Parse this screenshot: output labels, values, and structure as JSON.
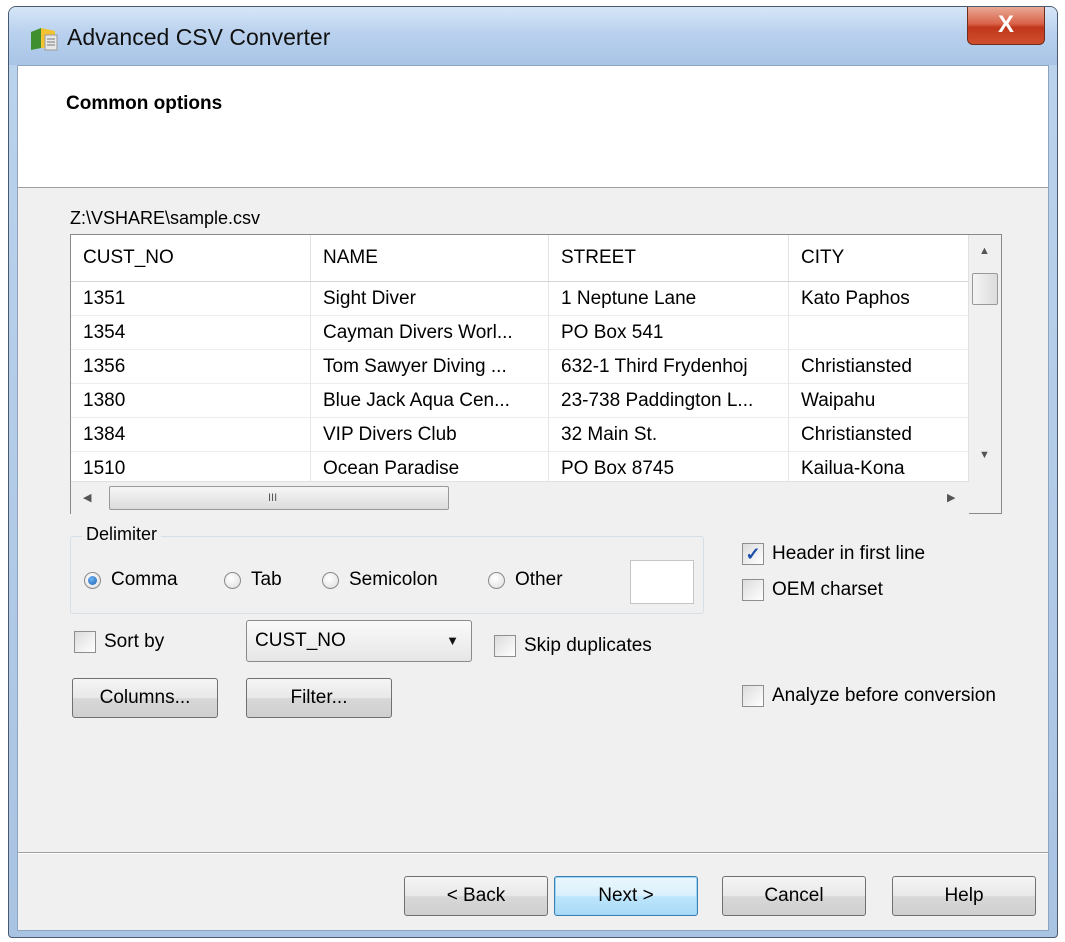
{
  "window": {
    "title": "Advanced CSV Converter",
    "close_glyph": "X"
  },
  "page": {
    "title": "Common options",
    "file_path": "Z:\\VSHARE\\sample.csv"
  },
  "grid": {
    "columns": [
      "CUST_NO",
      "NAME",
      "STREET",
      "CITY"
    ],
    "rows": [
      [
        "1351",
        "Sight Diver",
        "1 Neptune Lane",
        "Kato Paphos"
      ],
      [
        "1354",
        "Cayman Divers Worl...",
        "PO Box 541",
        ""
      ],
      [
        "1356",
        "Tom Sawyer Diving ...",
        "632-1 Third Frydenhoj",
        "Christiansted"
      ],
      [
        "1380",
        "Blue Jack Aqua Cen...",
        "23-738 Paddington L...",
        "Waipahu"
      ],
      [
        "1384",
        "VIP Divers Club",
        "32 Main St.",
        "Christiansted"
      ],
      [
        "1510",
        "Ocean Paradise",
        "PO Box 8745",
        "Kailua-Kona"
      ]
    ],
    "hscroll_grip": "III"
  },
  "delimiter": {
    "label": "Delimiter",
    "options": [
      "Comma",
      "Tab",
      "Semicolon",
      "Other"
    ],
    "selected": "Comma",
    "other_value": ""
  },
  "options": {
    "header_first_line": {
      "label": "Header in first line",
      "checked": true
    },
    "oem_charset": {
      "label": "OEM charset",
      "checked": false
    },
    "sort_by": {
      "label": "Sort by",
      "checked": false,
      "value": "CUST_NO"
    },
    "skip_duplicates": {
      "label": "Skip duplicates",
      "checked": false
    },
    "analyze": {
      "label": "Analyze before conversion",
      "checked": false
    }
  },
  "buttons": {
    "columns": "Columns...",
    "filter": "Filter...",
    "back": "< Back",
    "next": "Next >",
    "cancel": "Cancel",
    "help": "Help"
  }
}
